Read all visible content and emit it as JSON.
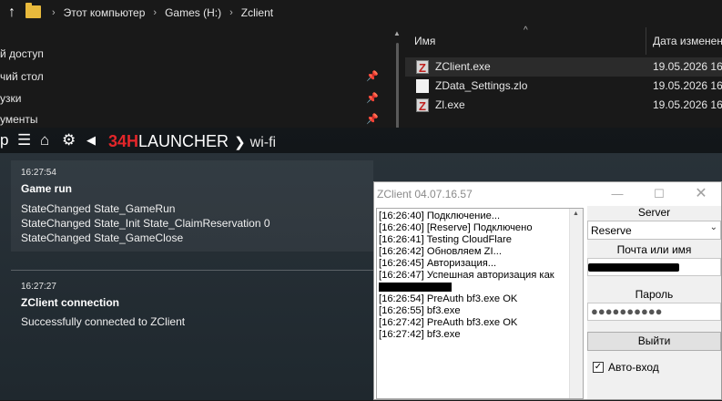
{
  "explorer": {
    "breadcrumb": [
      "Этот компьютер",
      "Games (H:)",
      "Zclient"
    ],
    "nav_items": [
      "й доступ",
      "чий стол",
      "узки",
      "ументы",
      "р"
    ],
    "columns": {
      "name": "Имя",
      "date": "Дата изменен"
    },
    "files": [
      {
        "name": "ZClient.exe",
        "date": "19.05.2026 16:24",
        "icon": "zclient-icon"
      },
      {
        "name": "ZData_Settings.zlo",
        "date": "19.05.2026 16:21",
        "icon": "document-icon"
      },
      {
        "name": "Zl.exe",
        "date": "19.05.2026 16:24",
        "icon": "zclient-icon"
      }
    ]
  },
  "launcher": {
    "brand_red": "34H",
    "brand_white": "LAUNCHER",
    "section": "wi-fi",
    "notifications": [
      {
        "time": "16:27:54",
        "title": "Game run",
        "lines": [
          "StateChanged State_GameRun",
          "StateChanged State_Init State_ClaimReservation 0",
          "StateChanged State_GameClose"
        ]
      },
      {
        "time": "16:27:27",
        "title": "ZClient connection",
        "lines": [
          "Successfully connected to ZClient"
        ]
      }
    ]
  },
  "zclient": {
    "title": "ZClient 04.07.16.57",
    "log": [
      "[16:26:40] Подключение...",
      "[16:26:40] [Reserve] Подключено",
      "[16:26:41] Testing CloudFlare",
      "[16:26:42] Обновляем ZI...",
      "[16:26:45] Авторизация...",
      "[16:26:47] Успешная авторизация как",
      "[16:26:54] PreAuth bf3.exe OK",
      "[16:26:55] bf3.exe",
      "[16:27:42] PreAuth bf3.exe OK",
      "[16:27:42] bf3.exe"
    ],
    "server_label": "Server",
    "server_value": "Reserve",
    "login_label": "Почта или имя",
    "password_label": "Пароль",
    "password_mask": "●●●●●●●●●●",
    "logout_label": "Выйти",
    "autologin_label": "Авто-вход",
    "autologin_checked": true
  }
}
